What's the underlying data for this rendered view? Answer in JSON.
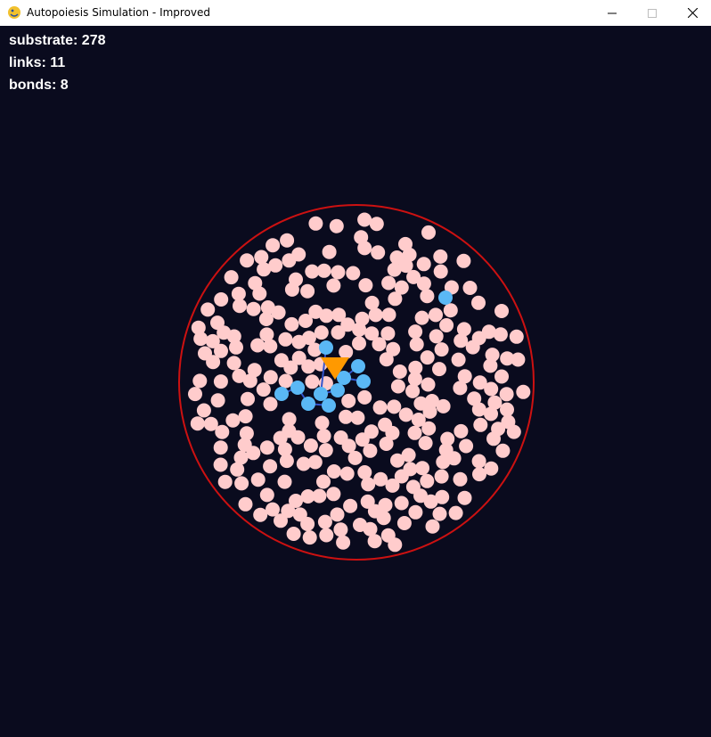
{
  "window": {
    "title": "Autopoiesis Simulation - Improved",
    "app_icon": "pygame-snake-icon"
  },
  "hud": {
    "substrate": "substrate: 278",
    "links": "links: 11",
    "bonds": "bonds: 8"
  },
  "colors": {
    "background": "#0a0b1e",
    "boundary": "#cc1111",
    "substrate": "#ffcccc",
    "link": "#5ab8f5",
    "bond": "#3355cc",
    "catalyst": "#ff9900"
  }
}
